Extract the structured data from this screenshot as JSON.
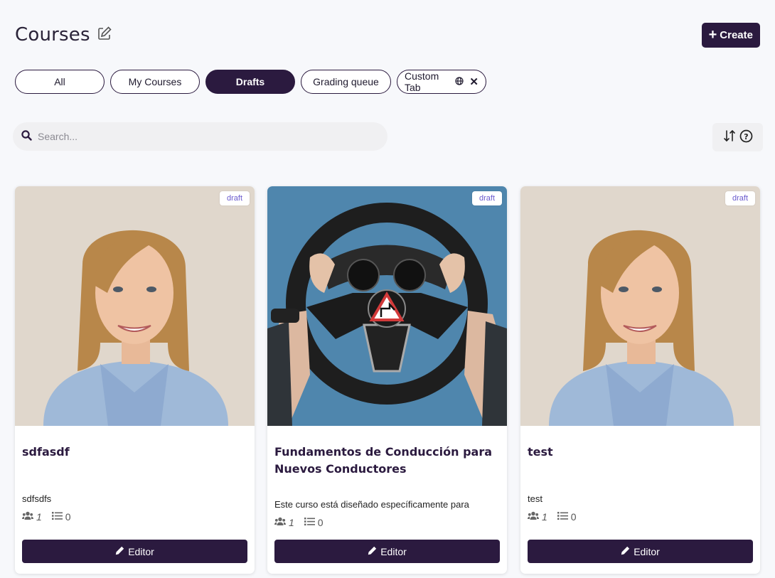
{
  "header": {
    "title": "Courses",
    "create_label": "Create"
  },
  "tabs": [
    {
      "label": "All"
    },
    {
      "label": "My Courses"
    },
    {
      "label": "Drafts",
      "active": true
    },
    {
      "label": "Grading queue"
    },
    {
      "label": "Custom Tab"
    }
  ],
  "search": {
    "placeholder": "Search...",
    "value": ""
  },
  "courses": [
    {
      "status": "draft",
      "title": "sdfasdf",
      "description": "sdfsdfs",
      "users": "1",
      "lessons": "0",
      "editor_label": "Editor",
      "image": "woman-portrait"
    },
    {
      "status": "draft",
      "title": "Fundamentos de Conducción para Nuevos Conductores",
      "description": "Este curso está diseñado específicamente para",
      "users": "1",
      "lessons": "0",
      "editor_label": "Editor",
      "image": "steering-wheel"
    },
    {
      "status": "draft",
      "title": "test",
      "description": "test",
      "users": "1",
      "lessons": "0",
      "editor_label": "Editor",
      "image": "woman-portrait"
    }
  ],
  "colors": {
    "accent": "#2b1a3f",
    "background": "#f7f8fb",
    "badge_text": "#6a5acd"
  }
}
